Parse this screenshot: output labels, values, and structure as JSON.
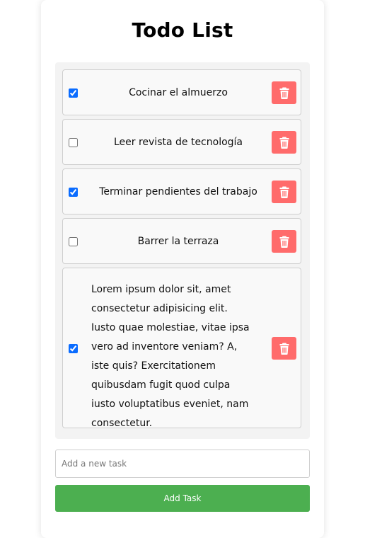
{
  "app": {
    "title": "Todo List"
  },
  "todos": [
    {
      "text": "Cocinar el almuerzo",
      "checked": true
    },
    {
      "text": "Leer revista de tecnología",
      "checked": false
    },
    {
      "text": "Terminar pendientes del trabajo",
      "checked": true
    },
    {
      "text": "Barrer la terraza",
      "checked": false
    },
    {
      "text": "Lorem ipsum dolor sit, amet consectetur adipisicing elit. Iusto quae molestiae, vitae ipsa vero ad inventore veniam? A, iste quis? Exercitationem quibusdam fugit quod culpa iusto voluptatibus eveniet, nam consectetur.",
      "checked": true
    }
  ],
  "new_task": {
    "value": "",
    "placeholder": "Add a new task"
  },
  "add_button": {
    "label": "Add Task"
  },
  "colors": {
    "delete_button": "#ff6b6b",
    "add_button": "#4caf50",
    "checkbox": "#0a6cff"
  },
  "icons": {
    "delete": "trash-icon"
  }
}
